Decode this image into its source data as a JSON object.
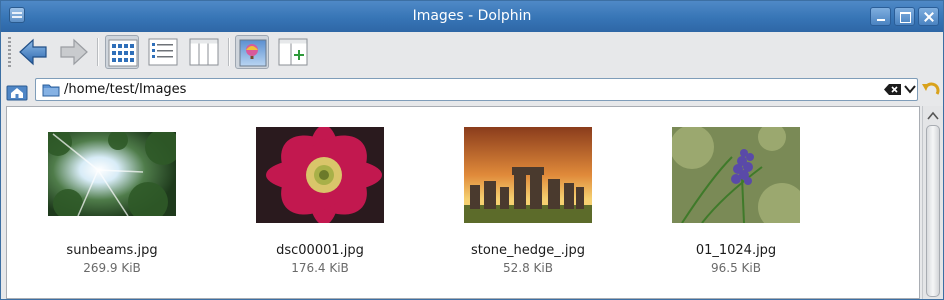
{
  "window": {
    "title": "Images - Dolphin",
    "minimize_icon": "minimize-icon",
    "maximize_icon": "maximize-icon",
    "close_icon": "close-icon"
  },
  "toolbar": {
    "buttons": [
      {
        "name": "back",
        "icon": "back-arrow-icon"
      },
      {
        "name": "forward",
        "icon": "forward-arrow-icon"
      },
      {
        "name": "icons-view",
        "icon": "icons-view-icon",
        "active": true
      },
      {
        "name": "details-view",
        "icon": "details-view-icon"
      },
      {
        "name": "columns-view",
        "icon": "columns-view-icon"
      },
      {
        "name": "preview",
        "icon": "preview-icon",
        "active": true
      },
      {
        "name": "split",
        "icon": "split-view-icon"
      }
    ]
  },
  "location": {
    "path": "/home/test/Images"
  },
  "files": [
    {
      "name": "sunbeams.jpg",
      "size": "269.9 KiB"
    },
    {
      "name": "dsc00001.jpg",
      "size": "176.4 KiB"
    },
    {
      "name": "stone_hedge_.jpg",
      "size": "52.8 KiB"
    },
    {
      "name": "01_1024.jpg",
      "size": "96.5 KiB"
    }
  ],
  "colors": {
    "titlebar": "#3775b6",
    "accent_blue": "#2f6fb9"
  }
}
